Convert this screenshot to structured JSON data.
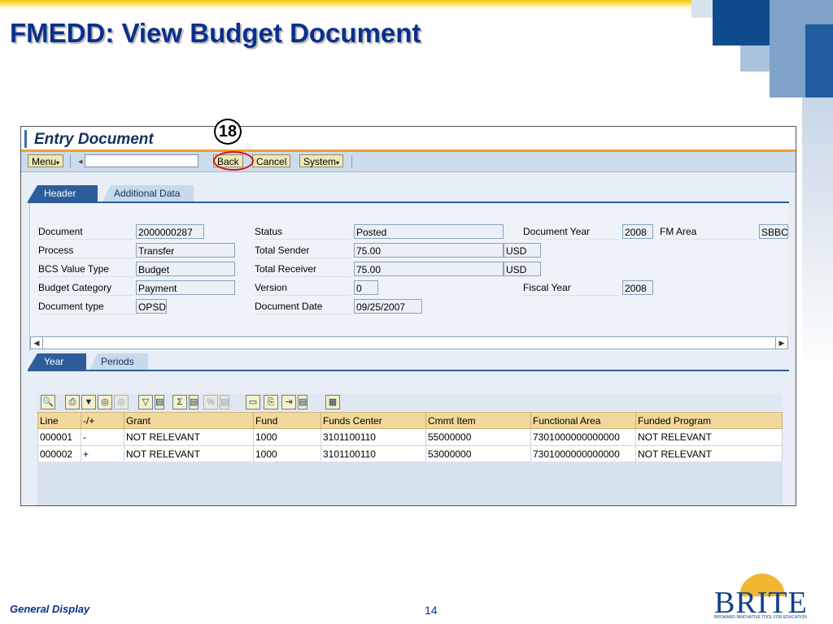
{
  "slide": {
    "title": "FMEDD: View Budget Document",
    "footer_left": "General Display",
    "page_number": "14",
    "logo_text": "BRITE",
    "logo_tagline": "BROWARD INNOVATIVE TOOL FOR EDUCATION",
    "callout_number": "18"
  },
  "window": {
    "title": "Entry Document"
  },
  "toolbar": {
    "menu_label": "Menu",
    "back_label": "Back",
    "cancel_label": "Cancel",
    "system_label": "System",
    "command_value": ""
  },
  "header_tabs": [
    {
      "label": "Header",
      "active": true
    },
    {
      "label": "Additional Data",
      "active": false
    }
  ],
  "header_fields": {
    "document": {
      "label": "Document",
      "value": "2000000287"
    },
    "process": {
      "label": "Process",
      "value": "Transfer"
    },
    "bcs_value_type": {
      "label": "BCS Value Type",
      "value": "Budget"
    },
    "budget_category": {
      "label": "Budget Category",
      "value": "Payment"
    },
    "document_type": {
      "label": "Document type",
      "value": "OPSD"
    },
    "status": {
      "label": "Status",
      "value": "Posted"
    },
    "total_sender": {
      "label": "Total Sender",
      "value": "75.00",
      "currency": "USD"
    },
    "total_receiver": {
      "label": "Total Receiver",
      "value": "75.00",
      "currency": "USD"
    },
    "version": {
      "label": "Version",
      "value": "0"
    },
    "document_date": {
      "label": "Document Date",
      "value": "09/25/2007"
    },
    "document_year": {
      "label": "Document Year",
      "value": "2008"
    },
    "fm_area": {
      "label": "FM Area",
      "value": "SBBC"
    },
    "fiscal_year": {
      "label": "Fiscal Year",
      "value": "2008"
    }
  },
  "line_tabs": [
    {
      "label": "Year",
      "active": true
    },
    {
      "label": "Periods",
      "active": false
    }
  ],
  "alv_icons": [
    "details-icon",
    "print-icon",
    "filter-icon",
    "find-icon",
    "find-next-icon",
    "set-filter-icon",
    "filter-menu-icon",
    "sum-icon",
    "sum-menu-icon",
    "subtotal-icon",
    "subtotal-menu-icon",
    "print-preview-icon",
    "export-icon",
    "export-spreadsheet-icon",
    "export-menu-icon",
    "layout-icon"
  ],
  "table": {
    "columns": [
      "Line",
      "-/+",
      "Grant",
      "Fund",
      "Funds Center",
      "Cmmt Item",
      "Functional Area",
      "Funded Program"
    ],
    "rows": [
      [
        "000001",
        "-",
        "NOT RELEVANT",
        "1000",
        "3101100110",
        "55000000",
        "7301000000000000",
        "NOT RELEVANT"
      ],
      [
        "000002",
        "+",
        "NOT RELEVANT",
        "1000",
        "3101100110",
        "53000000",
        "7301000000000000",
        "NOT RELEVANT"
      ]
    ]
  }
}
